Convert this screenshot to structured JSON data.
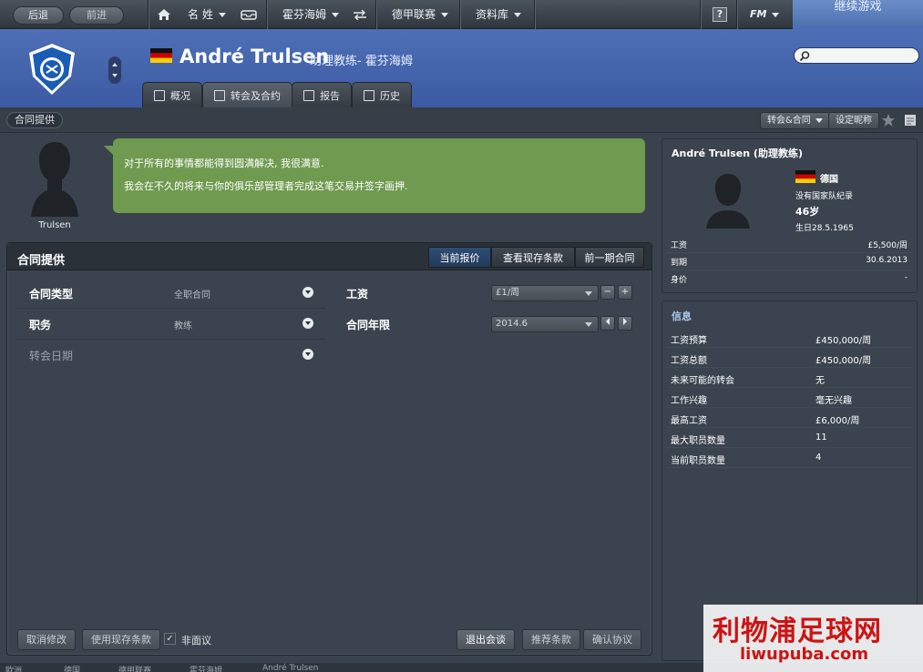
{
  "topbar": {
    "back": "后退",
    "forward": "前进",
    "menu_name": "名 姓",
    "menu_club": "霍芬海姆",
    "menu_league": "德甲联赛",
    "menu_database": "资料库",
    "help": "?",
    "fm": "FM",
    "continue": "继续游戏"
  },
  "header": {
    "name": "André Trulsen",
    "subtitle": "助理教练- 霍芬海姆",
    "search_placeholder": "",
    "tabs": [
      {
        "label": "概况"
      },
      {
        "label": "转会及合约"
      },
      {
        "label": "报告"
      },
      {
        "label": "历史"
      }
    ]
  },
  "subbar": {
    "title": "合同提供",
    "transfer_button": "转会&合同",
    "nickname_button": "设定昵称"
  },
  "portrait": {
    "label": "Trulsen"
  },
  "bubble": {
    "line1": "对于所有的事情都能得到圆满解决, 我很满意.",
    "line2": "我会在不久的将来与你的俱乐部管理者完成这笔交易并签字画押."
  },
  "contract": {
    "title": "合同提供",
    "tabs": [
      {
        "label": "当前报价"
      },
      {
        "label": "查看现存条款"
      },
      {
        "label": "前一期合同"
      }
    ],
    "contract_type_label": "合同类型",
    "contract_type_value": "全职合同",
    "role_label": "职务",
    "role_value": "教练",
    "transfer_date_label": "转会日期",
    "wage_label": "工资",
    "wage_value": "£1/周",
    "wage_minus": "−",
    "wage_plus": "+",
    "length_label": "合同年限",
    "length_value": "2014.6",
    "buttons": {
      "cancel": "取消修改",
      "use_existing": "使用现存条款",
      "non_contract": "非面议",
      "exit": "退出会谈",
      "suggest": "推荐条款",
      "confirm": "确认协议"
    }
  },
  "profile": {
    "title": "André Trulsen (助理教练)",
    "nation": "德国",
    "national_team": "没有国家队纪录",
    "age": "46岁",
    "birth": "生日28.5.1965",
    "rows": [
      {
        "k": "工资",
        "v": "£5,500/周"
      },
      {
        "k": "到期",
        "v": "30.6.2013"
      },
      {
        "k": "身价",
        "v": "-"
      }
    ]
  },
  "info": {
    "title": "信息",
    "rows": [
      {
        "k": "工资预算",
        "v": "£450,000/周"
      },
      {
        "k": "工资总额",
        "v": "£450,000/周"
      },
      {
        "k": "未来可能的转会",
        "v": "无"
      },
      {
        "k": "工作兴趣",
        "v": "毫无兴趣"
      },
      {
        "k": "最高工资",
        "v": "£6,000/周"
      },
      {
        "k": "最大职员数量",
        "v": "11"
      },
      {
        "k": "当前职员数量",
        "v": "4"
      }
    ]
  },
  "footer": {
    "crumbs": [
      "欧洲",
      "德国",
      "德甲联赛",
      "霍芬海姆",
      "André Trulsen"
    ]
  },
  "watermark": {
    "cn": "利物浦足球网",
    "en": "liwupuba.com"
  },
  "colors": {
    "header_blue": "#4563ad",
    "bubble_green": "#6f9a4f",
    "active_tab": "#2f4d74",
    "watermark_red": "#cc1414"
  }
}
